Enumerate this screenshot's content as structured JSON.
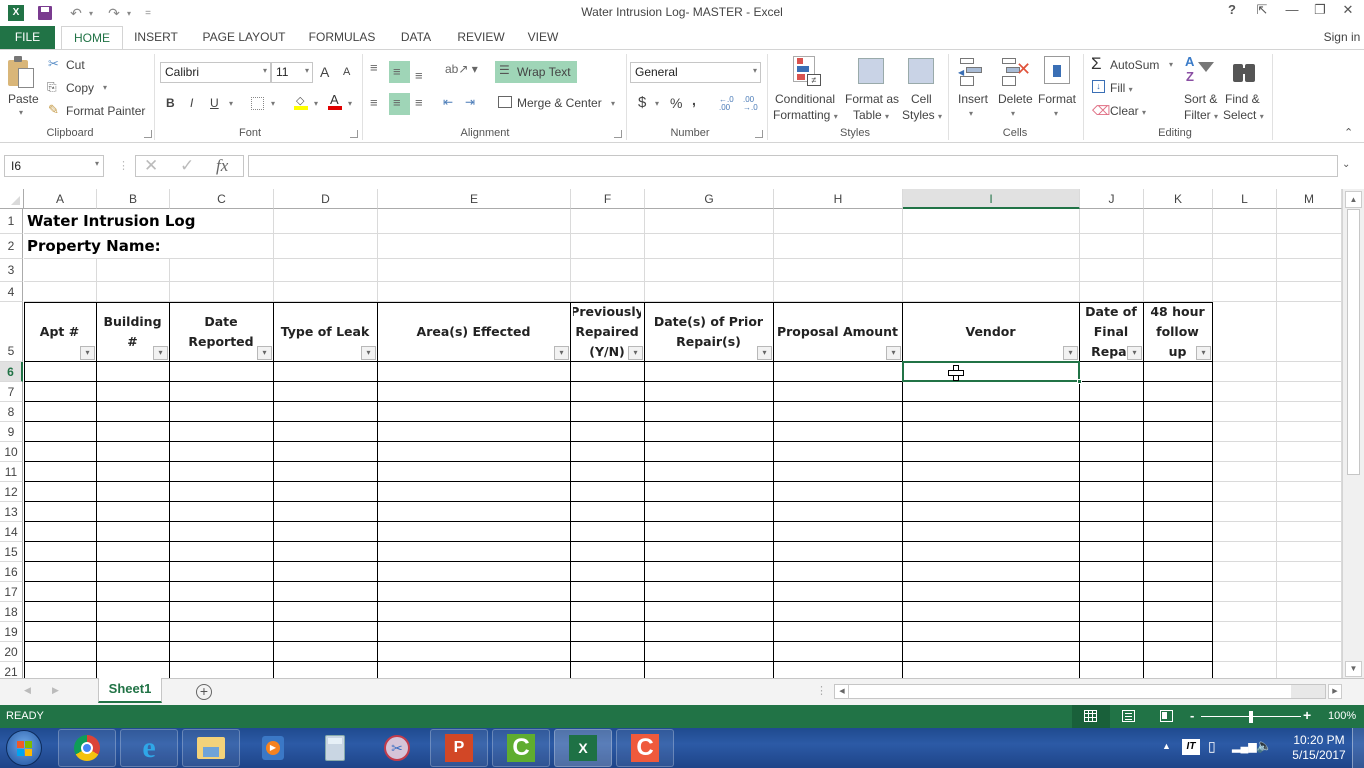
{
  "window": {
    "title": "Water Intrusion Log- MASTER - Excel",
    "buttons": {
      "help": "?",
      "ribbon_display": "⇱",
      "minimize": "—",
      "restore": "❐",
      "close": "✕"
    }
  },
  "quick_access": {
    "app_icon": "X",
    "save": "save-icon",
    "undo": "↶",
    "redo": "↷",
    "customize": "="
  },
  "ribbon_tabs": [
    "FILE",
    "HOME",
    "INSERT",
    "PAGE LAYOUT",
    "FORMULAS",
    "DATA",
    "REVIEW",
    "VIEW"
  ],
  "active_tab": "HOME",
  "sign_in": "Sign in",
  "ribbon": {
    "clipboard": {
      "label": "Clipboard",
      "paste": "Paste",
      "cut": "Cut",
      "copy": "Copy",
      "format_painter": "Format Painter"
    },
    "font": {
      "label": "Font",
      "font_name": "Calibri",
      "font_size": "11",
      "grow": "A",
      "shrink": "A",
      "bold": "B",
      "italic": "I",
      "underline": "U"
    },
    "alignment": {
      "label": "Alignment",
      "wrap_text": "Wrap Text",
      "merge_center": "Merge & Center"
    },
    "number": {
      "label": "Number",
      "format": "General",
      "currency": "$",
      "percent": "%",
      "comma": ",",
      "inc_decimal": "←.0 .00",
      "dec_decimal": ".00 →.0"
    },
    "styles": {
      "label": "Styles",
      "conditional_1": "Conditional",
      "conditional_2": "Formatting",
      "format_table_1": "Format as",
      "format_table_2": "Table",
      "cell_styles_1": "Cell",
      "cell_styles_2": "Styles"
    },
    "cells": {
      "label": "Cells",
      "insert": "Insert",
      "delete": "Delete",
      "format": "Format"
    },
    "editing": {
      "label": "Editing",
      "autosum": "AutoSum",
      "fill": "Fill",
      "clear": "Clear",
      "sort_1": "Sort &",
      "sort_2": "Filter",
      "find_1": "Find &",
      "find_2": "Select"
    }
  },
  "formula_bar": {
    "name_box": "I6",
    "cancel": "✕",
    "enter": "✓",
    "fx": "fx",
    "value": ""
  },
  "sheet": {
    "columns": [
      "A",
      "B",
      "C",
      "D",
      "E",
      "F",
      "G",
      "H",
      "I",
      "J",
      "K",
      "L",
      "M"
    ],
    "selected_column": "I",
    "rows": [
      "1",
      "2",
      "3",
      "4",
      "5",
      "6",
      "7",
      "8",
      "9",
      "10",
      "11",
      "12",
      "13",
      "14",
      "15",
      "16",
      "17",
      "18",
      "19",
      "20",
      "21"
    ],
    "selected_row": "6",
    "title": "Water Intrusion Log",
    "property_label": "Property Name:",
    "headers": [
      {
        "col": "A",
        "text": "Apt #"
      },
      {
        "col": "B",
        "text": "Building #"
      },
      {
        "col": "C",
        "text": "Date Reported"
      },
      {
        "col": "D",
        "text": "Type of Leak"
      },
      {
        "col": "E",
        "text": "Area(s) Effected"
      },
      {
        "col": "F",
        "text": "Previously Repaired (Y/N)"
      },
      {
        "col": "G",
        "text": "Date(s) of Prior Repair(s)"
      },
      {
        "col": "H",
        "text": "Proposal Amount"
      },
      {
        "col": "I",
        "text": "Vendor"
      },
      {
        "col": "J",
        "text": "Date of Final Repai"
      },
      {
        "col": "K",
        "text": "48 hour follow up"
      }
    ],
    "active_cell": "I6"
  },
  "sheet_tabs": {
    "tabs": [
      "Sheet1"
    ],
    "active": "Sheet1",
    "add": "+"
  },
  "status_bar": {
    "status": "READY",
    "zoom": "100%",
    "zoom_fraction": 0.5
  },
  "taskbar": {
    "apps": [
      "start",
      "chrome",
      "internet-explorer",
      "file-explorer",
      "media-player",
      "calculator",
      "snipping-tool",
      "powerpoint",
      "camtasia-green",
      "excel",
      "camtasia-red"
    ],
    "time": "10:20 PM",
    "date": "5/15/2017",
    "tray_it": "IT"
  }
}
